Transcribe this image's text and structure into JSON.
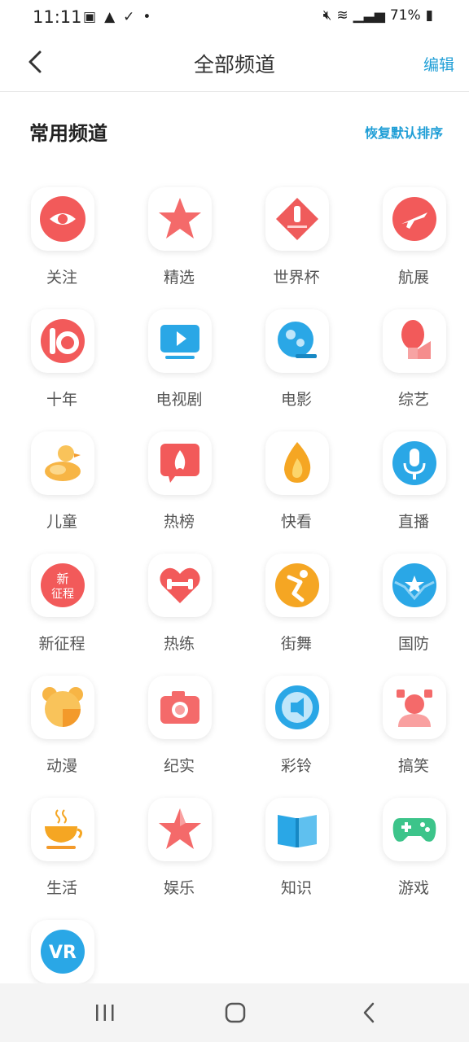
{
  "status": {
    "time": "11:11",
    "battery": "71%",
    "icons": [
      "image-icon",
      "warning-icon",
      "check-icon",
      "dot-icon"
    ],
    "right_icons": [
      "mute-icon",
      "wifi-icon",
      "signal-icon",
      "battery-icon"
    ]
  },
  "header": {
    "title": "全部频道",
    "edit": "编辑"
  },
  "section": {
    "title": "常用频道",
    "restore": "恢复默认排序"
  },
  "channels": [
    {
      "label": "关注",
      "icon": "eye-icon"
    },
    {
      "label": "精选",
      "icon": "star-icon"
    },
    {
      "label": "世界杯",
      "icon": "worldcup-icon"
    },
    {
      "label": "航展",
      "icon": "jet-icon"
    },
    {
      "label": "十年",
      "icon": "ten-icon"
    },
    {
      "label": "电视剧",
      "icon": "tv-icon"
    },
    {
      "label": "电影",
      "icon": "movie-icon"
    },
    {
      "label": "综艺",
      "icon": "variety-icon"
    },
    {
      "label": "儿童",
      "icon": "duck-icon"
    },
    {
      "label": "热榜",
      "icon": "hot-list-icon"
    },
    {
      "label": "快看",
      "icon": "flame-icon"
    },
    {
      "label": "直播",
      "icon": "mic-icon"
    },
    {
      "label": "新征程",
      "icon": "new-journey-icon"
    },
    {
      "label": "热练",
      "icon": "fitness-heart-icon"
    },
    {
      "label": "街舞",
      "icon": "dance-icon"
    },
    {
      "label": "国防",
      "icon": "defense-icon"
    },
    {
      "label": "动漫",
      "icon": "anime-icon"
    },
    {
      "label": "纪实",
      "icon": "camera-icon"
    },
    {
      "label": "彩铃",
      "icon": "ringtone-icon"
    },
    {
      "label": "搞笑",
      "icon": "funny-icon"
    },
    {
      "label": "生活",
      "icon": "cup-icon"
    },
    {
      "label": "娱乐",
      "icon": "ent-star-icon"
    },
    {
      "label": "知识",
      "icon": "book-icon"
    },
    {
      "label": "游戏",
      "icon": "gamepad-icon"
    },
    {
      "label": "",
      "icon": "vr-icon"
    }
  ],
  "glyphs": {
    "new_journey_top": "新",
    "new_journey_bottom": "征程",
    "vr": "VR"
  },
  "colors": {
    "accent": "#1f9ed6",
    "red": "#f25a5a",
    "blue": "#2aa7e6",
    "orange": "#f5a623"
  }
}
